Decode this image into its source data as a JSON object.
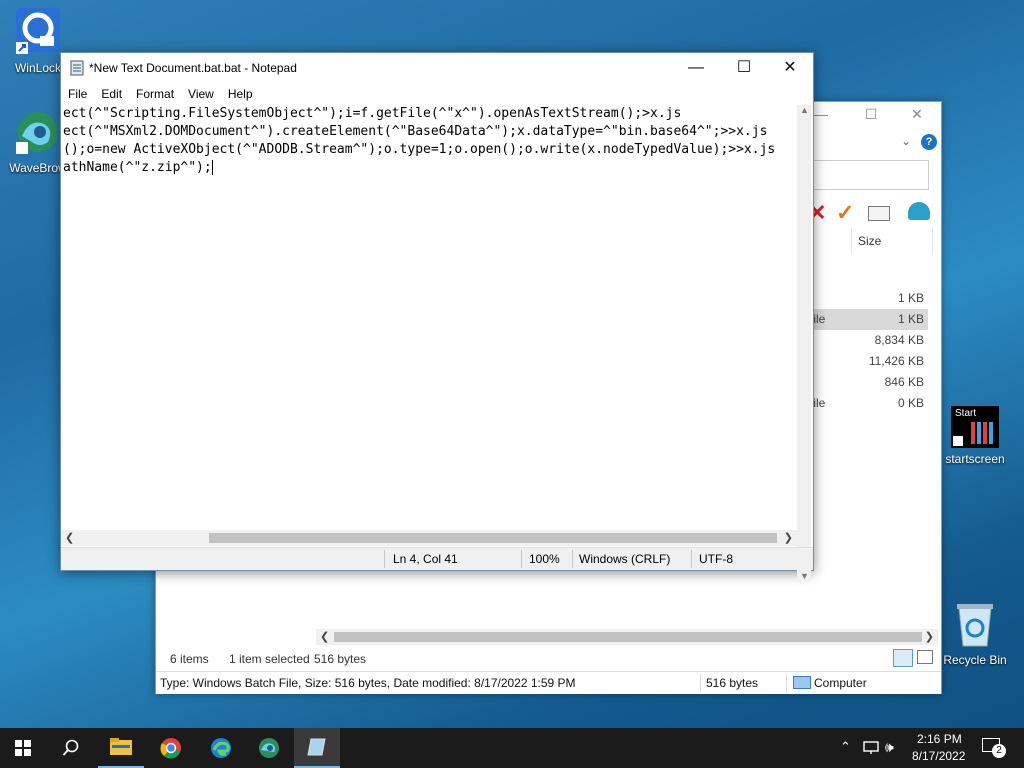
{
  "desktop": {
    "icons": [
      {
        "label": "WinLock"
      },
      {
        "label": "WaveBrow"
      },
      {
        "label": "startscreen",
        "tile_text": "Start"
      },
      {
        "label": "Recycle Bin"
      }
    ]
  },
  "explorer": {
    "column_size": "Size",
    "rows": [
      {
        "type": "",
        "size": "1 KB"
      },
      {
        "type": "h File",
        "size": "1 KB",
        "selected": true
      },
      {
        "type": "",
        "size": "8,834 KB"
      },
      {
        "type": "",
        "size": "11,426 KB"
      },
      {
        "type": "",
        "size": "846 KB"
      },
      {
        "type": "h File",
        "size": "0 KB"
      }
    ],
    "status_items": "6 items",
    "status_selected": "1 item selected",
    "status_bytes": "516 bytes",
    "details": "Type: Windows Batch File, Size: 516 bytes, Date modified: 8/17/2022 1:59 PM",
    "details_size": "516 bytes",
    "details_location": "Computer"
  },
  "notepad": {
    "title": "*New Text Document.bat.bat - Notepad",
    "menu": [
      "File",
      "Edit",
      "Format",
      "View",
      "Help"
    ],
    "lines": [
      "ect(^\"Scripting.FileSystemObject^\");i=f.getFile(^\"x^\").openAsTextStream();>x.js",
      "ect(^\"MSXml2.DOMDocument^\").createElement(^\"Base64Data^\");x.dataType=^\"bin.base64^\";>>x.js",
      "();o=new ActiveXObject(^\"ADODB.Stream^\");o.type=1;o.open();o.write(x.nodeTypedValue);>>x.js",
      "athName(^\"z.zip^\");"
    ],
    "status": {
      "position": "Ln 4, Col 41",
      "zoom": "100%",
      "line_ending": "Windows (CRLF)",
      "encoding": "UTF-8"
    }
  },
  "taskbar": {
    "time": "2:16 PM",
    "date": "8/17/2022",
    "notifications": "2"
  },
  "colors": {
    "accent": "#0078d7",
    "taskbar": "#1b1b1b"
  }
}
